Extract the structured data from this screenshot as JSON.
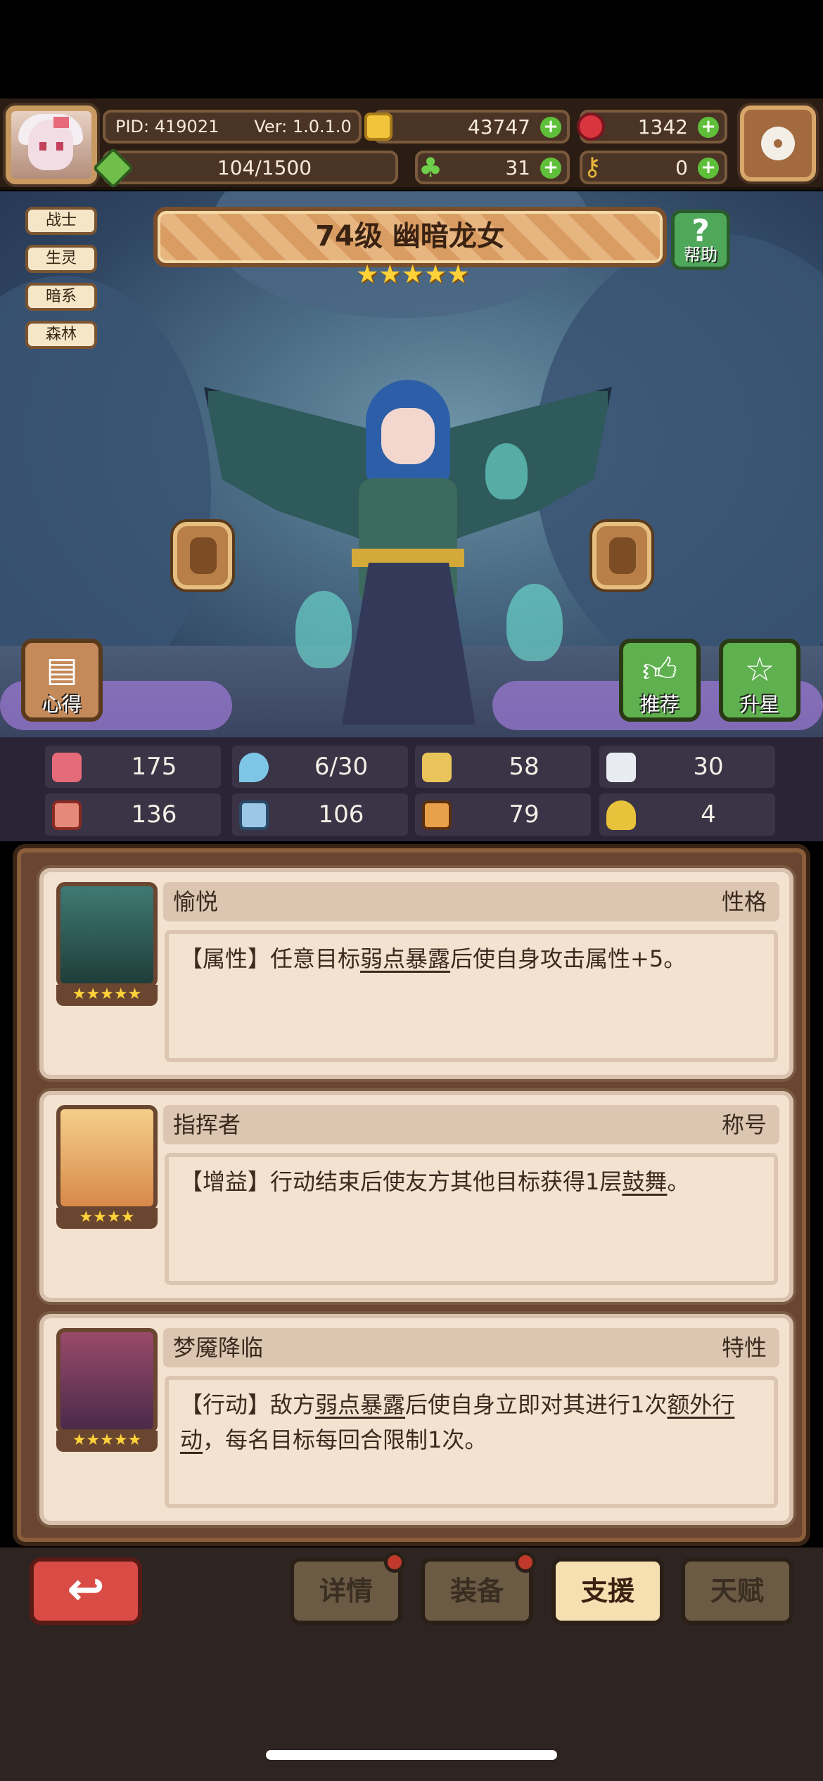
{
  "header": {
    "pid": "PID: 419021",
    "version": "Ver: 1.0.1.0",
    "xp": "104/1500",
    "gold": "43747",
    "gems": "1342",
    "clovers": "31",
    "keys": "0"
  },
  "traits": [
    "战士",
    "生灵",
    "暗系",
    "森林"
  ],
  "hero": {
    "title": "74级  幽暗龙女",
    "stars": "★★★★★",
    "help_label": "帮助",
    "help_glyph": "?"
  },
  "scene_buttons": {
    "xinde": "心得",
    "tuijian": "推荐",
    "shengxing": "升星"
  },
  "stats": [
    {
      "icon": "heart-icon",
      "value": "175"
    },
    {
      "icon": "mana-drop-icon",
      "value": "6/30"
    },
    {
      "icon": "defense-shield-icon",
      "value": "58"
    },
    {
      "icon": "speed-wing-icon",
      "value": "30"
    },
    {
      "icon": "attack-fist-icon",
      "value": "136"
    },
    {
      "icon": "magic-book-icon",
      "value": "106"
    },
    {
      "icon": "resist-icon",
      "value": "79"
    },
    {
      "icon": "luck-horseshoe-icon",
      "value": "4"
    }
  ],
  "cards": [
    {
      "name": "愉悦",
      "type": "性格",
      "stars": "★★★★★",
      "desc_before": "【属性】任意目标",
      "desc_link": "弱点暴露",
      "desc_after": "后使自身攻击属性+5。",
      "desc_tail": ""
    },
    {
      "name": "指挥者",
      "type": "称号",
      "stars": "★★★★",
      "desc_before": "【增益】行动结束后使友方其他目标获得1层",
      "desc_link": "鼓舞",
      "desc_after": "。",
      "desc_tail": ""
    },
    {
      "name": "梦魇降临",
      "type": "特性",
      "stars": "★★★★★",
      "desc_before": "【行动】敌方",
      "desc_link": "弱点暴露",
      "desc_after": "后使自身立即对其进行1次",
      "desc_link2": "额外行动",
      "desc_tail": "，每名目标每回合限制1次。"
    }
  ],
  "tabs": {
    "back_glyph": "↩",
    "details": "详情",
    "equipment": "装备",
    "support": "支援",
    "talent": "天赋"
  }
}
